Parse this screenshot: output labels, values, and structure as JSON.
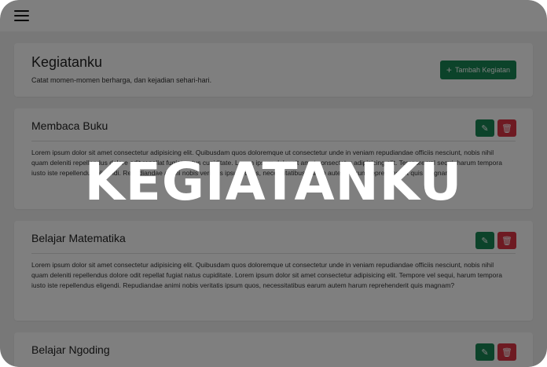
{
  "header": {
    "title": "Kegiatanku",
    "subtitle": "Catat momen-momen berharga, dan kejadian sehari-hari.",
    "add_button_label": "Tambah Kegiatan"
  },
  "activities": [
    {
      "title": "Membaca Buku",
      "description": "Lorem ipsum dolor sit amet consectetur adipisicing elit. Quibusdam quos doloremque ut consectetur unde in veniam repudiandae officiis nesciunt, nobis nihil quam deleniti repellendus dolore odit repellat fugiat natus cupiditate. Lorem ipsum dolor sit amet consectetur adipisicing elit. Tempore vel sequi, harum tempora iusto iste repellendus eligendi. Repudiandae animi nobis veritatis ipsum quos, necessitatibus earum autem harum reprehenderit quis magnam?"
    },
    {
      "title": "Belajar Matematika",
      "description": "Lorem ipsum dolor sit amet consectetur adipisicing elit. Quibusdam quos doloremque ut consectetur unde in veniam repudiandae officiis nesciunt, nobis nihil quam deleniti repellendus dolore odit repellat fugiat natus cupiditate. Lorem ipsum dolor sit amet consectetur adipisicing elit. Tempore vel sequi, harum tempora iusto iste repellendus eligendi. Repudiandae animi nobis veritatis ipsum quos, necessitatibus earum autem harum reprehenderit quis magnam?"
    },
    {
      "title": "Belajar Ngoding",
      "description": ""
    }
  ],
  "overlay": {
    "text": "KEGIATANKU"
  },
  "icons": {
    "menu": "hamburger-icon",
    "add": "plus-icon",
    "edit": "pencil-icon",
    "delete": "trash-icon"
  },
  "colors": {
    "success": "#198754",
    "danger": "#dc3545",
    "overlay": "rgba(0,0,0,0.5)"
  }
}
